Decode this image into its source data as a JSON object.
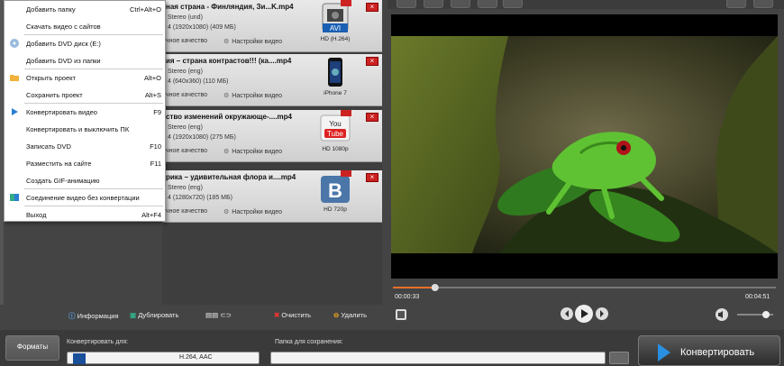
{
  "menu": {
    "items": [
      {
        "label": "Добавить папку",
        "key": "Ctrl+Alt+O"
      },
      {
        "label": "Скачать видео с сайтов",
        "key": ""
      },
      {
        "label": "Добавить DVD диск (E:)",
        "key": ""
      },
      {
        "label": "Добавить DVD из папки",
        "key": ""
      },
      {
        "label": "Открыть проект",
        "key": "Alt+O"
      },
      {
        "label": "Сохранить проект",
        "key": "Alt+S"
      },
      {
        "label": "Конвертировать видео",
        "key": "F9"
      },
      {
        "label": "Конвертировать и выключить ПК",
        "key": ""
      },
      {
        "label": "Записать DVD",
        "key": "F10"
      },
      {
        "label": "Разместить на сайте",
        "key": "F11"
      },
      {
        "label": "Создать GIF-анимацию",
        "key": ""
      },
      {
        "label": "Соединение видео без конвертации",
        "key": ""
      },
      {
        "label": "Выход",
        "key": "Alt+F4"
      }
    ]
  },
  "files": [
    {
      "title": "ная страна - Финляндия, Зи...K.mp4",
      "audio": "Stereo (und)",
      "video": "4 (1920x1080) (409 МБ)",
      "quality": "чное качество",
      "settings": "Настройки видео",
      "format": "HD (H.264)",
      "format_icon": "avi-icon",
      "badge": "AVI"
    },
    {
      "title": "ия – страна контрастов!!! (ка....mp4",
      "audio": "Stereo (eng)",
      "video": "4 (640x360) (110 МБ)",
      "quality": "чное качество",
      "settings": "Настройки видео",
      "format": "iPhone 7",
      "format_icon": "iphone-icon",
      "badge": ""
    },
    {
      "title": "ство изменений окружающе-....mp4",
      "audio": "Stereo (eng)",
      "video": "4 (1920x1080) (275 МБ)",
      "quality": "чное качество",
      "settings": "Настройки видео",
      "format": "HD 1080p",
      "format_icon": "youtube-icon",
      "badge": "You Tube"
    },
    {
      "title": "рика – удивительная флора и....mp4",
      "audio": "Stereo (eng)",
      "video": "4 (1280x720) (185 МБ)",
      "quality": "чное качество",
      "settings": "Настройки видео",
      "format": "HD 720p",
      "format_icon": "vk-icon",
      "badge": "B"
    }
  ],
  "toolbar": {
    "info": "Информация",
    "dup": "Дублировать",
    "clear": "Очистить",
    "delete": "Удалить"
  },
  "player": {
    "current": "00:00:33",
    "total": "00:04:51",
    "progress": 0.11,
    "volume": 0.8
  },
  "bottom": {
    "formats": "Форматы",
    "convert_to": "Конвертировать для:",
    "codec": "H.264, AAC",
    "save_folder": "Папка для сохранения:",
    "convert": "Конвертировать"
  },
  "colors": {
    "accent": "#e8702a",
    "close": "#cc2222"
  }
}
